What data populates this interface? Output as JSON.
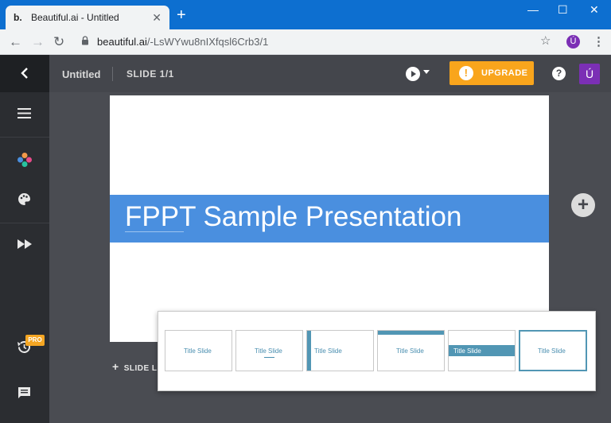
{
  "browser": {
    "tab_favicon": "b.",
    "tab_title": "Beautiful.ai - Untitled",
    "tab_close": "✕",
    "new_tab": "+",
    "minimize": "—",
    "maximize": "☐",
    "close": "✕",
    "url_host": "beautiful.ai",
    "url_path": "/-LsWYwu8nIXfqsl6Crb3/1",
    "profile_initial": "Ú"
  },
  "app": {
    "doc_title": "Untitled",
    "slide_indicator": "SLIDE 1/1",
    "upgrade_label": "UPGRADE",
    "help_label": "?",
    "user_initial": "Ú",
    "pro_badge": "PRO",
    "slide_layout_label": "SLIDE LA",
    "add_symbol": "+"
  },
  "slide": {
    "title": "FPPT Sample Presentation",
    "accent_color": "#4a8fdf"
  },
  "layouts": [
    {
      "label": "Title Slide",
      "style": "plain"
    },
    {
      "label": "Title Slide",
      "style": "underline"
    },
    {
      "label": "Title Slide",
      "style": "left-bar"
    },
    {
      "label": "Title Slide",
      "style": "top-bar"
    },
    {
      "label": "Title Slide",
      "style": "band"
    },
    {
      "label": "Title Slide",
      "style": "selected"
    }
  ],
  "colors": {
    "chrome_blue": "#0d6fd0",
    "upgrade_orange": "#f9a51c",
    "user_purple": "#7b2fb5",
    "sidebar": "#2b2d31"
  }
}
